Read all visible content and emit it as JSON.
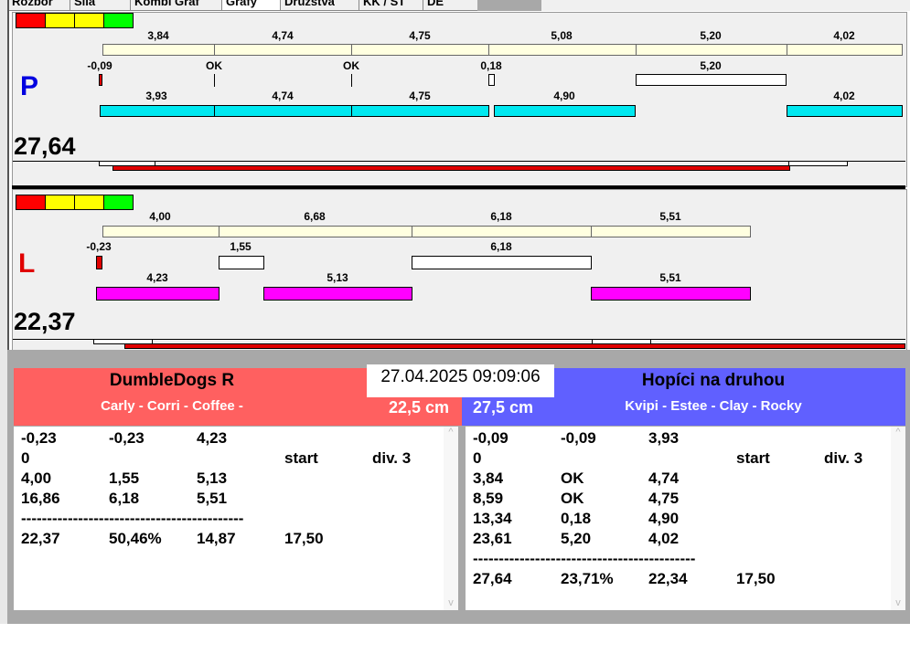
{
  "tabs": [
    "Rozbor",
    "Síla",
    "Kombi Graf",
    "Grafy",
    "Družstva",
    "KK / ST",
    "DE"
  ],
  "top": {
    "letter": "P",
    "score": "27,64",
    "row1": [
      "3,84",
      "4,74",
      "4,75",
      "5,08",
      "5,20",
      "4,02"
    ],
    "row2": [
      "-0,09",
      "OK",
      "OK",
      "0,18",
      "5,20"
    ],
    "row3": [
      "3,93",
      "4,74",
      "4,75",
      "4,90",
      "4,02"
    ]
  },
  "bottom": {
    "letter": "L",
    "score": "22,37",
    "row1": [
      "4,00",
      "6,68",
      "6,18",
      "5,51"
    ],
    "row2": [
      "-0,23",
      "1,55",
      "6,18"
    ],
    "row3": [
      "4,23",
      "5,13",
      "5,51"
    ]
  },
  "colors": {
    "team_left": "#ff6060",
    "team_right": "#6060ff",
    "lane_p": "#0000e0",
    "lane_l": "#e00000"
  },
  "datetime": "27.04.2025 09:09:06",
  "left_team": {
    "name": "DumbleDogs R",
    "dogs": "Carly - Corri - Coffee -",
    "height": "22,5 cm",
    "rows": [
      [
        "-0,23",
        "-0,23",
        "4,23",
        "",
        ""
      ],
      [
        "0",
        "",
        "",
        "start",
        "div. 3"
      ],
      [
        "4,00",
        "1,55",
        "5,13",
        "",
        ""
      ],
      [
        "16,86",
        "6,18",
        "5,51",
        "",
        ""
      ],
      [
        "-------------------------------------------",
        "",
        "",
        "",
        ""
      ],
      [
        "22,37",
        "50,46%",
        "14,87",
        "17,50",
        ""
      ]
    ]
  },
  "right_team": {
    "name": "Hopíci na druhou",
    "dogs": "Kvipi - Estee - Clay - Rocky",
    "height": "27,5 cm",
    "rows": [
      [
        "-0,09",
        "-0,09",
        "3,93",
        "",
        ""
      ],
      [
        "0",
        "",
        "",
        "start",
        "div. 3"
      ],
      [
        "3,84",
        "OK",
        "4,74",
        "",
        ""
      ],
      [
        "8,59",
        "OK",
        "4,75",
        "",
        ""
      ],
      [
        "13,34",
        "0,18",
        "4,90",
        "",
        ""
      ],
      [
        "23,61",
        "5,20",
        "4,02",
        "",
        ""
      ],
      [
        "-------------------------------------------",
        "",
        "",
        "",
        ""
      ],
      [
        "27,64",
        "23,71%",
        "22,34",
        "17,50",
        ""
      ]
    ]
  }
}
